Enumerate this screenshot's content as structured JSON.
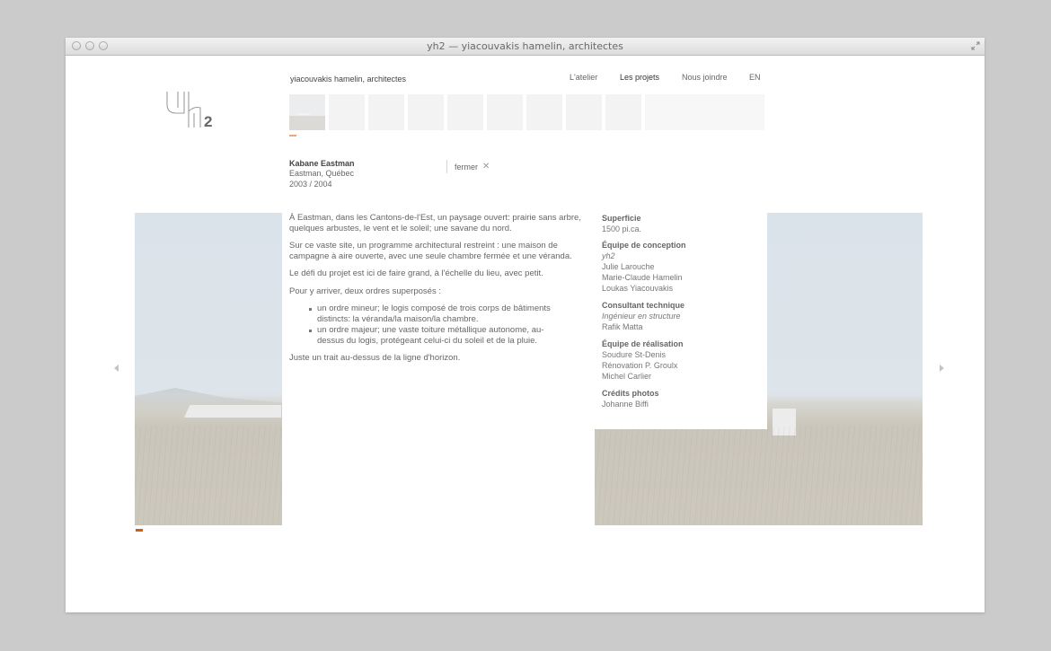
{
  "window": {
    "title": "yh2 — yiacouvakis hamelin, architectes"
  },
  "header": {
    "site_name": "yiacouvakis hamelin, architectes",
    "nav": [
      {
        "label": "L'atelier"
      },
      {
        "label": "Les projets"
      },
      {
        "label": "Nous joindre"
      },
      {
        "label": "EN"
      }
    ]
  },
  "thumbnails": {
    "count": 9,
    "active_index": 0
  },
  "project": {
    "title": "Kabane Eastman",
    "location": "Eastman, Québec",
    "years": "2003 / 2004",
    "close_label": "fermer"
  },
  "description": {
    "paragraphs": [
      "À Eastman, dans les Cantons-de-l'Est, un paysage ouvert: prairie sans arbre, quelques arbustes, le vent et le soleil; une savane du nord.",
      "Sur ce vaste site, un programme architectural restreint : une maison de campagne à aire ouverte, avec une seule chambre fermée et une véranda.",
      "Le défi du projet est ici de faire grand, à l'échelle du lieu, avec petit.",
      "Pour y arriver, deux ordres superposés :"
    ],
    "bullets": [
      "un ordre mineur; le logis composé de trois corps de bâtiments distincts: la véranda/la maison/la chambre.",
      "un ordre majeur; une vaste toiture métallique autonome, au-dessus du logis, protégeant celui-ci du soleil et de la pluie."
    ],
    "closing": "Juste un trait au-dessus de la ligne d'horizon."
  },
  "credits": {
    "surface_label": "Superficie",
    "surface_value": "1500 pi.ca.",
    "design_label": "Équipe de conception",
    "design_firm": "yh2",
    "design_members": [
      "Julie Larouche",
      "Marie-Claude Hamelin",
      "Loukas Yiacouvakis"
    ],
    "tech_label": "Consultant technique",
    "tech_role": "Ingénieur en structure",
    "tech_name": "Rafik Matta",
    "build_label": "Équipe de réalisation",
    "build_members": [
      "Soudure St-Denis",
      "Rénovation P. Groulx",
      "Michel Carlier"
    ],
    "photo_label": "Crédits photos",
    "photo_name": "Johanne Biffi"
  },
  "colors": {
    "accent": "#d35d11",
    "thumb_indicator": "#e9a77e"
  },
  "icons": {
    "prev": "chevron-left-icon",
    "next": "chevron-right-icon",
    "close": "close-icon",
    "fullscreen": "fullscreen-icon"
  }
}
